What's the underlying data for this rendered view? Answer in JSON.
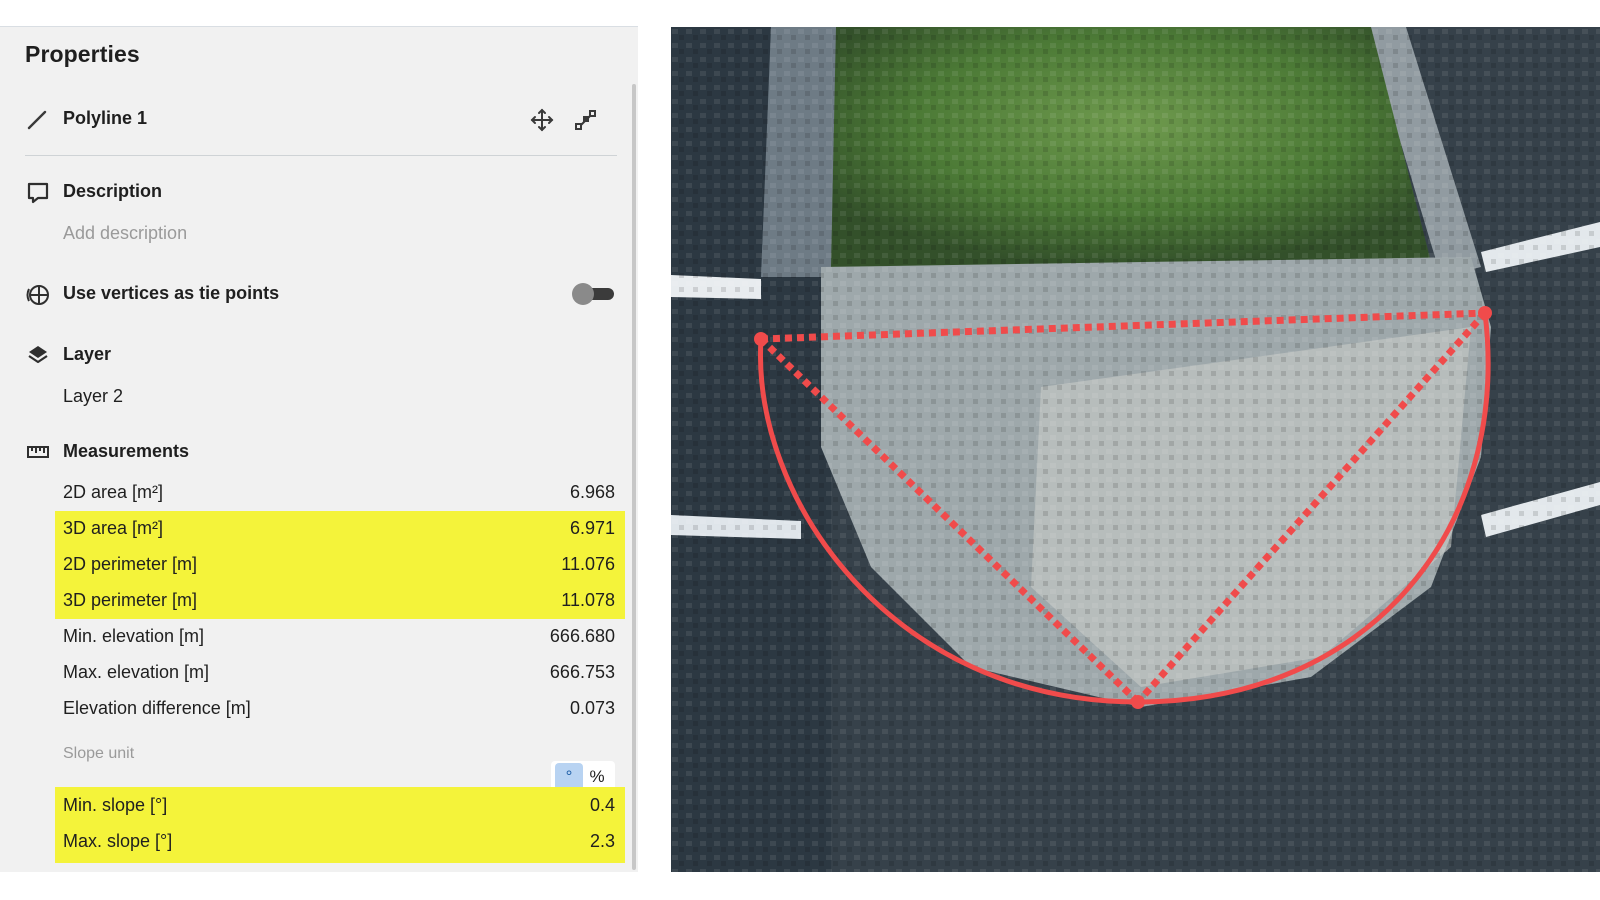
{
  "panel": {
    "title": "Properties",
    "object_name": "Polyline 1",
    "description": {
      "heading": "Description",
      "placeholder": "Add description"
    },
    "tie_points": {
      "label": "Use vertices as tie points",
      "enabled": false
    },
    "layer": {
      "heading": "Layer",
      "value": "Layer 2"
    },
    "measurements": {
      "heading": "Measurements",
      "rows": [
        {
          "label": "2D area [m²]",
          "value": "6.968",
          "highlighted": false
        },
        {
          "label": "3D area [m²]",
          "value": "6.971",
          "highlighted": true
        },
        {
          "label": "2D perimeter [m]",
          "value": "11.076",
          "highlighted": true
        },
        {
          "label": "3D perimeter [m]",
          "value": "11.078",
          "highlighted": true
        },
        {
          "label": "Min. elevation [m]",
          "value": "666.680",
          "highlighted": false
        },
        {
          "label": "Max. elevation [m]",
          "value": "666.753",
          "highlighted": false
        },
        {
          "label": "Elevation difference [m]",
          "value": "0.073",
          "highlighted": false
        }
      ],
      "slope_unit": {
        "label": "Slope unit",
        "options": [
          "°",
          "%"
        ],
        "selected": "°"
      },
      "slope_rows": [
        {
          "label": "Min. slope [°]",
          "value": "0.4",
          "highlighted": true
        },
        {
          "label": "Max. slope [°]",
          "value": "2.3",
          "highlighted": true
        }
      ]
    }
  },
  "icons": {
    "object": "polyline-icon",
    "move": "move-icon",
    "edit": "edit-vertices-icon",
    "description": "comment-icon",
    "tie_points": "tie-point-icon",
    "layer": "layers-icon",
    "measurements": "ruler-icon"
  },
  "colors": {
    "highlight": "#f4f33a",
    "polyline": "#f04b4b",
    "selected_toggle": "#b8d3f2"
  }
}
